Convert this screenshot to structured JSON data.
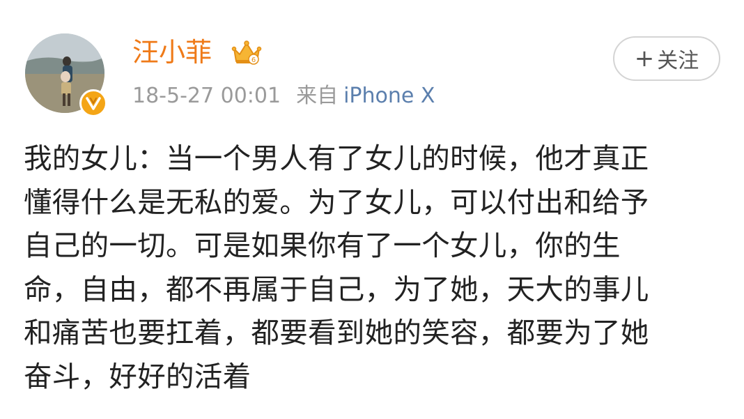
{
  "user": {
    "name": "汪小菲",
    "crown_level": "6"
  },
  "post_meta": {
    "timestamp": "18-5-27 00:01",
    "source_prefix": "来自",
    "device": "iPhone X"
  },
  "follow_button": {
    "plus": "+",
    "label": "关注"
  },
  "post": {
    "lines": [
      "我的女儿：当一个男人有了女儿的时候，他才真正",
      "懂得什么是无私的爱。为了女儿，可以付出和给予",
      "自己的一切。可是如果你有了一个女儿，你的生",
      "命，自由，都不再属于自己，为了她，天大的事儿",
      "和痛苦也要扛着，都要看到她的笑容，都要为了她",
      "奋斗，好好的活着"
    ]
  },
  "colors": {
    "username": "#ef7a18",
    "meta_text": "#9a9a9a",
    "device": "#5b7fad",
    "body_text": "#222222",
    "badge": "#f4a516"
  },
  "icons": {
    "avatar": "profile-photo",
    "verified": "verified-v-badge-icon",
    "crown": "crown-icon"
  }
}
